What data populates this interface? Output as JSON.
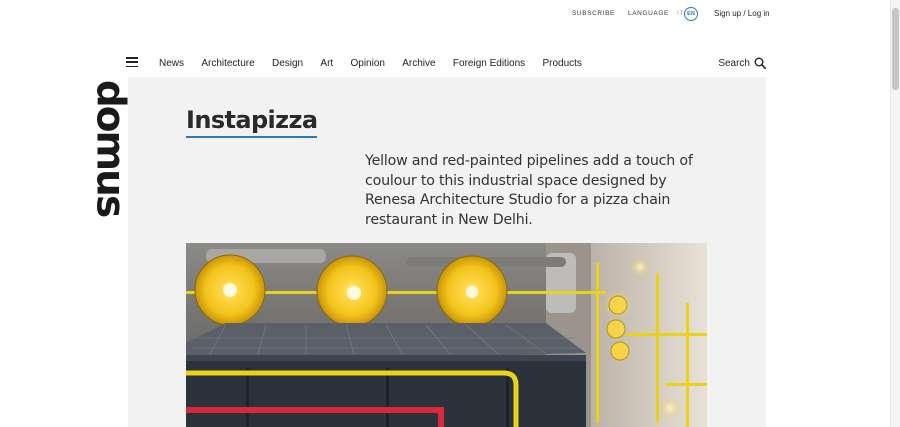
{
  "utility": {
    "subscribe": "SUBSCRIBE",
    "language": "LANGUAGE",
    "lang_it": "IT",
    "lang_en": "EN",
    "signin": "Sign up / Log in"
  },
  "nav": {
    "items": [
      "News",
      "Architecture",
      "Design",
      "Art",
      "Opinion",
      "Archive",
      "Foreign Editions",
      "Products"
    ],
    "search_label": "Search"
  },
  "logo": {
    "text": "domus"
  },
  "article": {
    "title": "Instapizza",
    "summary": "Yellow and red-painted pipelines add a touch of coulour to this industrial space designed by Renesa Architecture Studio for a pizza chain restaurant in New Delhi."
  },
  "colors": {
    "accent": "#2a7ab8",
    "panel": "#f2f2f2",
    "pipe_yellow": "#e8d21a",
    "pipe_red": "#d8283a"
  }
}
